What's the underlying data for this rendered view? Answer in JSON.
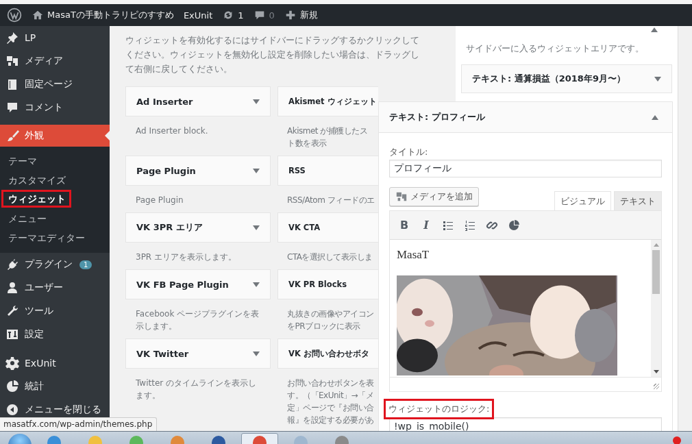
{
  "admin_bar": {
    "site_name": "MasaTの手動トラリピのすすめ",
    "items": [
      {
        "kind": "plugin",
        "label": "ExUnit",
        "muted": false
      },
      {
        "kind": "updates",
        "label": "1",
        "muted": false
      },
      {
        "kind": "comments",
        "label": "0",
        "muted": true
      },
      {
        "kind": "new",
        "label": "新規",
        "muted": false
      }
    ]
  },
  "menu_groups": [
    [
      {
        "kind": "pin",
        "label": "LP",
        "current": false
      },
      {
        "kind": "media",
        "label": "メディア",
        "current": false
      },
      {
        "kind": "page",
        "label": "固定ページ",
        "current": false
      },
      {
        "kind": "comment",
        "label": "コメント",
        "current": false
      }
    ],
    [
      {
        "kind": "brush",
        "label": "外観",
        "current": true,
        "children": [
          {
            "label": "テーマ",
            "selected": false,
            "highlighted": false
          },
          {
            "label": "カスタマイズ",
            "selected": false,
            "highlighted": false
          },
          {
            "label": "ウィジェット",
            "selected": true,
            "highlighted": true
          },
          {
            "label": "メニュー",
            "selected": false,
            "highlighted": false
          },
          {
            "label": "テーマエディター",
            "selected": false,
            "highlighted": false
          }
        ]
      },
      {
        "kind": "plug",
        "label": "プラグイン",
        "current": false,
        "badge": "1"
      },
      {
        "kind": "user",
        "label": "ユーザー",
        "current": false
      },
      {
        "kind": "wrench",
        "label": "ツール",
        "current": false
      },
      {
        "kind": "sliders",
        "label": "設定",
        "current": false
      }
    ],
    [
      {
        "kind": "gear",
        "label": "ExUnit",
        "current": false
      },
      {
        "kind": "pie",
        "label": "統計",
        "current": false
      },
      {
        "kind": "collapse",
        "label": "メニューを閉じる",
        "current": false
      }
    ]
  ],
  "available": {
    "intro": "ウィジェットを有効化するにはサイドバーにドラッグするかクリックしてください。ウィジェットを無効化し設定を削除したい場合は、ドラッグして右側に戻してください。",
    "widgets": [
      {
        "title": "Ad Inserter",
        "description": [
          "Ad Inserter block."
        ],
        "expanded": false
      },
      {
        "title": "Akismet ウィジェット",
        "description": [
          "Akismet が捕獲したス",
          "ト数を表示"
        ]
      },
      {
        "title": "Page Plugin",
        "description": [
          "Page Plugin"
        ],
        "expanded": false
      },
      {
        "title": "RSS",
        "description": [
          "RSS/Atom フィードのエ"
        ]
      },
      {
        "title": "VK 3PR エリア",
        "description": [
          "3PR エリアを表示します。"
        ],
        "expanded": false
      },
      {
        "title": "VK CTA",
        "description": [
          "CTAを選択して表示しま"
        ]
      },
      {
        "title": "VK FB Page Plugin",
        "description": [
          "Facebook ページプラグインを表",
          "示します。"
        ],
        "expanded": false
      },
      {
        "title": "VK PR Blocks",
        "description": [
          "丸抜きの画像やアイコン",
          "をPRブロックに表示"
        ]
      },
      {
        "title": "VK Twitter",
        "description": [
          "Twitter のタイムラインを表示し",
          "ます。"
        ],
        "expanded": false
      },
      {
        "title": "VK お問い合わせボタ",
        "description": [
          "お問い合わせボタンを表",
          "す。（「ExUnit」→「メ",
          "定」ページで『お問い合",
          "報』を設定する必要があ"
        ]
      }
    ]
  },
  "sidebar_area": {
    "expanded": true,
    "description": "サイドバーに入るウィジェットエリアです。",
    "widgets": [
      {
        "title": "テキスト: 通算損益（2018年9月〜）",
        "expanded": false
      }
    ]
  },
  "open_widget": {
    "title": "テキスト: プロフィール",
    "expanded": true,
    "title_label": "タイトル:",
    "title_value": "プロフィール",
    "add_media": "メディアを追加",
    "editor_tabs": [
      {
        "label": "ビジュアル",
        "selected": true
      },
      {
        "label": "テキスト",
        "selected": false
      }
    ],
    "toolbar": [
      {
        "kind": "bold",
        "glyph": "B"
      },
      {
        "kind": "italic",
        "glyph": "I"
      },
      {
        "kind": "bullets"
      },
      {
        "kind": "numbers"
      },
      {
        "kind": "link"
      },
      {
        "kind": "pie"
      }
    ],
    "content_text": "MasaT",
    "logic_label": "ウィジェットのロジック:",
    "logic_highlighted": true,
    "logic_value": "!wp_is_mobile()"
  },
  "status_url": "masatfx.com/wp-admin/themes.php"
}
